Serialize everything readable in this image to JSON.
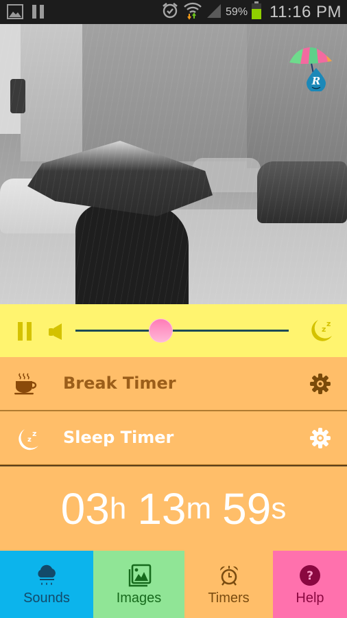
{
  "status_bar": {
    "left_icons": [
      "gallery-icon",
      "pause-icon"
    ],
    "right_icons": [
      "alarm-icon",
      "wifi-icon",
      "signal-icon",
      "battery-icon"
    ],
    "battery_percent": "59%",
    "battery_level": 0.59,
    "time": "11:16 PM"
  },
  "header_image": {
    "description": "Black and white photo of person with umbrella walking in rainy city street",
    "logo_icon": "rain-umbrella-logo-icon",
    "logo_letter": "R"
  },
  "player": {
    "pause_icon": "pause-icon",
    "volume_icon": "speaker-icon",
    "volume_level": 0.4,
    "sleep_icon": "moon-sleep-icon",
    "colors": {
      "background": "#fff46f",
      "icon": "#d4c200",
      "track": "#1d4a55",
      "thumb": "#ff8cc0"
    }
  },
  "timers": [
    {
      "label": "Break Timer",
      "icon": "coffee-cup-icon",
      "settings_icon": "gear-icon",
      "active": false
    },
    {
      "label": "Sleep Timer",
      "icon": "moon-sleep-icon",
      "settings_icon": "gear-icon",
      "active": true
    }
  ],
  "countdown": {
    "hours": "03",
    "hours_unit": "h",
    "minutes": "13",
    "minutes_unit": "m",
    "seconds": "59",
    "seconds_unit": "s"
  },
  "bottom_nav": [
    {
      "label": "Sounds",
      "icon": "rain-cloud-icon",
      "color": "#0cb4ec"
    },
    {
      "label": "Images",
      "icon": "images-icon",
      "color": "#90e596"
    },
    {
      "label": "Timers",
      "icon": "alarm-clock-icon",
      "color": "#ffbe69",
      "selected": true
    },
    {
      "label": "Help",
      "icon": "question-icon",
      "color": "#ff71ad"
    }
  ]
}
